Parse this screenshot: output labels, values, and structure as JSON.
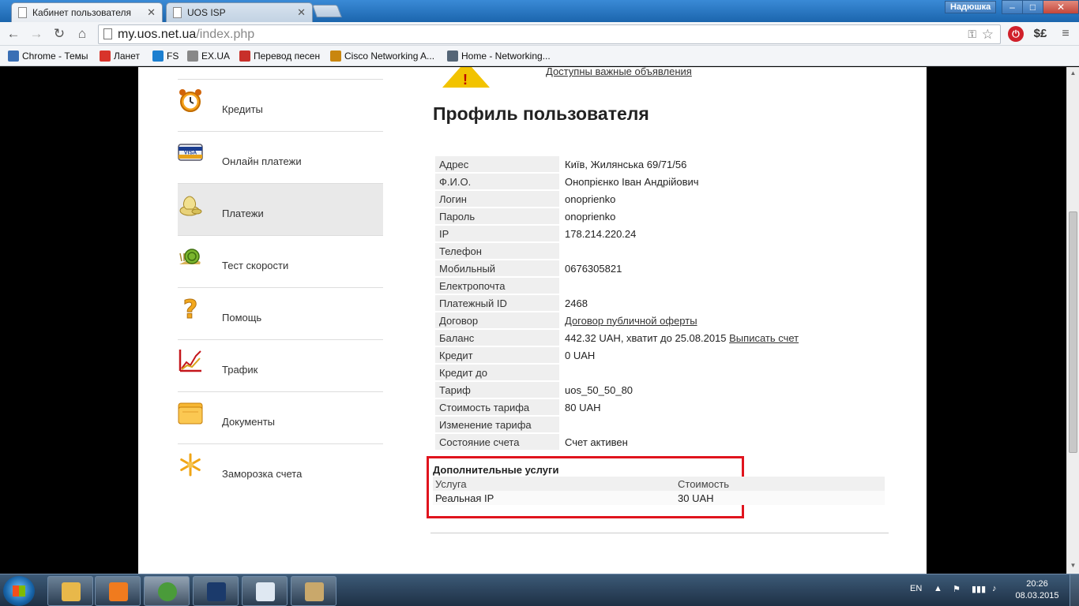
{
  "browser": {
    "tabs": [
      {
        "title": "Кабинет пользователя",
        "active": true
      },
      {
        "title": "UOS ISP",
        "active": false
      }
    ],
    "user_badge": "Надюшка",
    "window_controls": {
      "minimize": "–",
      "maximize": "□",
      "close": "✕"
    },
    "nav": {
      "back": "←",
      "forward": "→",
      "reload": "↻",
      "home": "⌂"
    },
    "url": {
      "host": "my.uos.net.ua",
      "path": "/index.php"
    },
    "omnibox_icons": {
      "key": "⚿",
      "star": "☆"
    },
    "extensions": {
      "power": "⏻",
      "dollar": "$£",
      "menu": "≡"
    },
    "bookmarks": [
      {
        "label": "Chrome - Темы",
        "color": "#3a6fb5"
      },
      {
        "label": "Ланет",
        "color": "#d8342b"
      },
      {
        "label": "FS",
        "color": "#1c7fd0"
      },
      {
        "label": "EX.UA",
        "color": "#888888"
      },
      {
        "label": "Перевод песен",
        "color": "#c8302a"
      },
      {
        "label": "Cisco Networking A...",
        "color": "#c9860f"
      },
      {
        "label": "Home - Networking...",
        "color": "#556677"
      }
    ]
  },
  "sidebar": {
    "items": [
      {
        "label": "Кредиты",
        "icon": "alarm-clock-icon",
        "active": false
      },
      {
        "label": "Онлайн платежи",
        "icon": "visa-card-icon",
        "active": false
      },
      {
        "label": "Платежи",
        "icon": "money-bag-icon",
        "active": true
      },
      {
        "label": "Тест скорости",
        "icon": "snail-icon",
        "active": false
      },
      {
        "label": "Помощь",
        "icon": "question-icon",
        "active": false
      },
      {
        "label": "Трафик",
        "icon": "chart-icon",
        "active": false
      },
      {
        "label": "Документы",
        "icon": "folder-icon",
        "active": false
      },
      {
        "label": "Заморозка счета",
        "icon": "snowflake-icon",
        "active": false
      }
    ]
  },
  "notice": {
    "text": "Доступны важные объявления",
    "warn_mark": "!"
  },
  "profile": {
    "title": "Профиль пользователя",
    "rows": [
      {
        "key": "Адрес",
        "value": "Київ, Жилянська 69/71/56"
      },
      {
        "key": "Ф.И.О.",
        "value": "Онопрієнко Іван Андрійович"
      },
      {
        "key": "Логин",
        "value": "onoprienko"
      },
      {
        "key": "Пароль",
        "value": "onoprienko"
      },
      {
        "key": "IP",
        "value": "178.214.220.24"
      },
      {
        "key": "Телефон",
        "value": ""
      },
      {
        "key": "Мобильный",
        "value": "0676305821"
      },
      {
        "key": "Електропочта",
        "value": ""
      },
      {
        "key": "Платежный ID",
        "value": "2468"
      },
      {
        "key": "Договор",
        "value": "",
        "link": "Договор публичной оферты"
      },
      {
        "key": "Баланс",
        "value": "442.32 UAH, хватит до 25.08.2015 ",
        "link": "Выписать счет"
      },
      {
        "key": "Кредит",
        "value": "0 UAH"
      },
      {
        "key": "Кредит до",
        "value": ""
      },
      {
        "key": "Тариф",
        "value": "uos_50_50_80"
      },
      {
        "key": "Стоимость тарифа",
        "value": "80 UAH"
      },
      {
        "key": "Изменение тарифа",
        "value": ""
      },
      {
        "key": "Состояние счета",
        "value": "Счет активен"
      }
    ]
  },
  "extra_services": {
    "title": "Дополнительные услуги",
    "headers": [
      "Услуга",
      "Стоимость"
    ],
    "rows": [
      [
        "Реальная IP",
        "30 UAH"
      ]
    ],
    "highlight_color": "#e0141e"
  },
  "taskbar": {
    "apps": [
      {
        "name": "explorer",
        "color": "#e8b84a"
      },
      {
        "name": "media-player",
        "color": "#f07b1e"
      },
      {
        "name": "chrome",
        "color": "#4a9b3a"
      },
      {
        "name": "photoshop",
        "color": "#1b3a6b"
      },
      {
        "name": "notepad",
        "color": "#dfe8f2"
      },
      {
        "name": "paint",
        "color": "#c9a86b"
      }
    ],
    "lang": "EN",
    "time": "20:26",
    "date": "08.03.2015"
  }
}
